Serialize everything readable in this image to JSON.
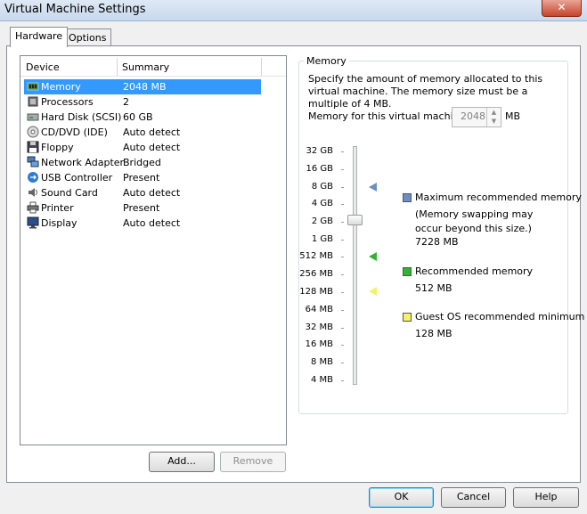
{
  "window": {
    "title": "Virtual Machine Settings",
    "close_glyph": "✕"
  },
  "tabs": [
    {
      "label": "Hardware"
    },
    {
      "label": "Options"
    }
  ],
  "device_list": {
    "headers": {
      "device": "Device",
      "summary": "Summary"
    },
    "items": [
      {
        "name": "Memory",
        "summary": "2048 MB",
        "icon": "memory-icon"
      },
      {
        "name": "Processors",
        "summary": "2",
        "icon": "processor-icon"
      },
      {
        "name": "Hard Disk (SCSI)",
        "summary": "60 GB",
        "icon": "hard-disk-icon"
      },
      {
        "name": "CD/DVD (IDE)",
        "summary": "Auto detect",
        "icon": "cd-dvd-icon"
      },
      {
        "name": "Floppy",
        "summary": "Auto detect",
        "icon": "floppy-icon"
      },
      {
        "name": "Network Adapter",
        "summary": "Bridged",
        "icon": "network-adapter-icon"
      },
      {
        "name": "USB Controller",
        "summary": "Present",
        "icon": "usb-icon"
      },
      {
        "name": "Sound Card",
        "summary": "Auto detect",
        "icon": "sound-card-icon"
      },
      {
        "name": "Printer",
        "summary": "Present",
        "icon": "printer-icon"
      },
      {
        "name": "Display",
        "summary": "Auto detect",
        "icon": "display-icon"
      }
    ]
  },
  "list_buttons": {
    "add": "Add...",
    "remove": "Remove"
  },
  "memory_panel": {
    "group_title": "Memory",
    "description": "Specify the amount of memory allocated to this virtual machine. The memory size must be a multiple of 4 MB.",
    "field_label": "Memory for this virtual machine:",
    "field_value": "2048",
    "unit": "MB",
    "scale_labels": [
      "32 GB",
      "16 GB",
      "8 GB",
      "4 GB",
      "2 GB",
      "1 GB",
      "512 MB",
      "256 MB",
      "128 MB",
      "64 MB",
      "32 MB",
      "16 MB",
      "8 MB",
      "4 MB"
    ],
    "legend": [
      {
        "title": "Maximum recommended memory",
        "note": "(Memory swapping may occur beyond this size.)",
        "value": "7228 MB",
        "color": "#6b8fc4"
      },
      {
        "title": "Recommended memory",
        "note": "",
        "value": "512 MB",
        "color": "#33b233"
      },
      {
        "title": "Guest OS recommended minimum",
        "note": "",
        "value": "128 MB",
        "color": "#f5f16b"
      }
    ]
  },
  "footer": {
    "ok": "OK",
    "cancel": "Cancel",
    "help": "Help"
  }
}
